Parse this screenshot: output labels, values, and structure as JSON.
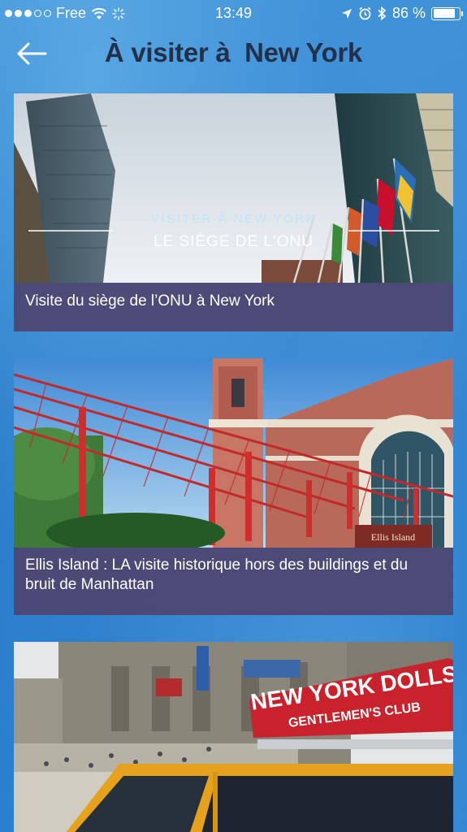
{
  "status_bar": {
    "carrier": "Free",
    "time": "13:49",
    "battery": "86 %",
    "battery_level": 0.86,
    "icons": [
      "signal-dots-icon",
      "wifi-icon",
      "activity-spinner-icon",
      "location-arrow-icon",
      "alarm-icon",
      "bluetooth-icon",
      "battery-icon"
    ]
  },
  "header": {
    "back_icon": "back-arrow-icon",
    "title": "À visiter à  New York"
  },
  "articles": [
    {
      "image_overlay_line1": "VISITER À NEW YORK",
      "image_overlay_line2": "LE SIÈGE DE L'ONU",
      "title": "Visite du siège de l’ONU à New York"
    },
    {
      "image_sign": "Ellis Island",
      "title": "Ellis Island : LA visite historique hors des buildings et du bruit de Manhattan"
    },
    {
      "image_sign_line1": "NEW YORK DOLLS",
      "image_sign_line2": "GENTLEMEN'S CLUB"
    }
  ],
  "colors": {
    "background": "#2278c8",
    "title": "#23304a",
    "caption_bg": "#4e4670"
  }
}
